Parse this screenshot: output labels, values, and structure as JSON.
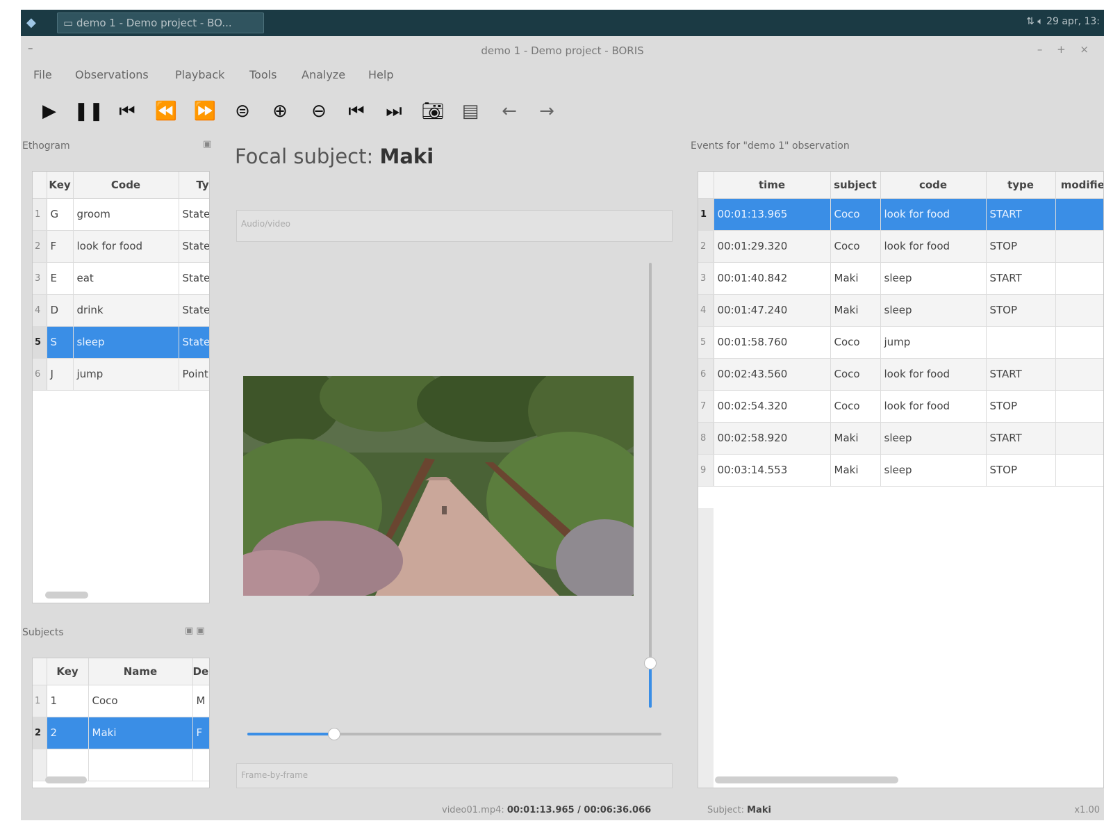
{
  "taskbar": {
    "task_label": "demo 1 - Demo project - BO...",
    "tray_text": "29 apr, 13:"
  },
  "window": {
    "title": "demo 1 - Demo project - BORIS",
    "controls": "– + ×"
  },
  "menu": [
    "File",
    "Observations",
    "Playback",
    "Tools",
    "Analyze",
    "Help"
  ],
  "toolbar": {
    "icons": [
      "play-icon",
      "pause-icon",
      "jump-to-start-icon",
      "rewind-icon",
      "fast-forward-icon",
      "reset-speed-icon",
      "increase-speed-icon",
      "decrease-speed-icon",
      "previous-media-icon",
      "next-media-icon",
      "snapshot-icon",
      "frame-mode-icon",
      "back-arrow-icon",
      "forward-arrow-icon"
    ]
  },
  "ethogram": {
    "title": "Ethogram",
    "headers": [
      "Key",
      "Code",
      "Type"
    ],
    "rows": [
      {
        "n": "1",
        "key": "G",
        "code": "groom",
        "type": "State event",
        "selected": false
      },
      {
        "n": "2",
        "key": "F",
        "code": "look for food",
        "type": "State event",
        "selected": false
      },
      {
        "n": "3",
        "key": "E",
        "code": "eat",
        "type": "State event",
        "selected": false
      },
      {
        "n": "4",
        "key": "D",
        "code": "drink",
        "type": "State event",
        "selected": false
      },
      {
        "n": "5",
        "key": "S",
        "code": "sleep",
        "type": "State event",
        "selected": true
      },
      {
        "n": "6",
        "key": "J",
        "code": "jump",
        "type": "Point event",
        "selected": false
      }
    ]
  },
  "subjects": {
    "title": "Subjects",
    "headers": [
      "Key",
      "Name",
      "Description"
    ],
    "rows": [
      {
        "n": "1",
        "key": "1",
        "name": "Coco",
        "desc": "M",
        "selected": false
      },
      {
        "n": "2",
        "key": "2",
        "name": "Maki",
        "desc": "F",
        "selected": true
      }
    ]
  },
  "center": {
    "focal_label": "Focal subject:",
    "focal_value": "Maki",
    "top_field": "Audio/video",
    "bottom_field": "Frame-by-frame",
    "volume_level": 0.1,
    "position_level": 0.21
  },
  "events": {
    "title": "Events for \"demo 1\" observation",
    "headers": [
      "time",
      "subject",
      "code",
      "type",
      "modifier"
    ],
    "rows": [
      {
        "n": "1",
        "time": "00:01:13.965",
        "subject": "Coco",
        "code": "look for food",
        "type": "START",
        "selected": true
      },
      {
        "n": "2",
        "time": "00:01:29.320",
        "subject": "Coco",
        "code": "look for food",
        "type": "STOP",
        "selected": false
      },
      {
        "n": "3",
        "time": "00:01:40.842",
        "subject": "Maki",
        "code": "sleep",
        "type": "START",
        "selected": false
      },
      {
        "n": "4",
        "time": "00:01:47.240",
        "subject": "Maki",
        "code": "sleep",
        "type": "STOP",
        "selected": false
      },
      {
        "n": "5",
        "time": "00:01:58.760",
        "subject": "Coco",
        "code": "jump",
        "type": "",
        "selected": false
      },
      {
        "n": "6",
        "time": "00:02:43.560",
        "subject": "Coco",
        "code": "look for food",
        "type": "START",
        "selected": false
      },
      {
        "n": "7",
        "time": "00:02:54.320",
        "subject": "Coco",
        "code": "look for food",
        "type": "STOP",
        "selected": false
      },
      {
        "n": "8",
        "time": "00:02:58.920",
        "subject": "Maki",
        "code": "sleep",
        "type": "START",
        "selected": false
      },
      {
        "n": "9",
        "time": "00:03:14.553",
        "subject": "Maki",
        "code": "sleep",
        "type": "STOP",
        "selected": false
      }
    ]
  },
  "status": {
    "media_label": "video01.mp4:",
    "media_time": "00:01:13.965 / 00:06:36.066",
    "subject_label": "Subject:",
    "subject_value": "Maki",
    "right_text": "x1.00"
  },
  "colors": {
    "selection": "#3a8ee6",
    "taskbar": "#1b3a44",
    "window_bg": "#dcdcdc"
  }
}
